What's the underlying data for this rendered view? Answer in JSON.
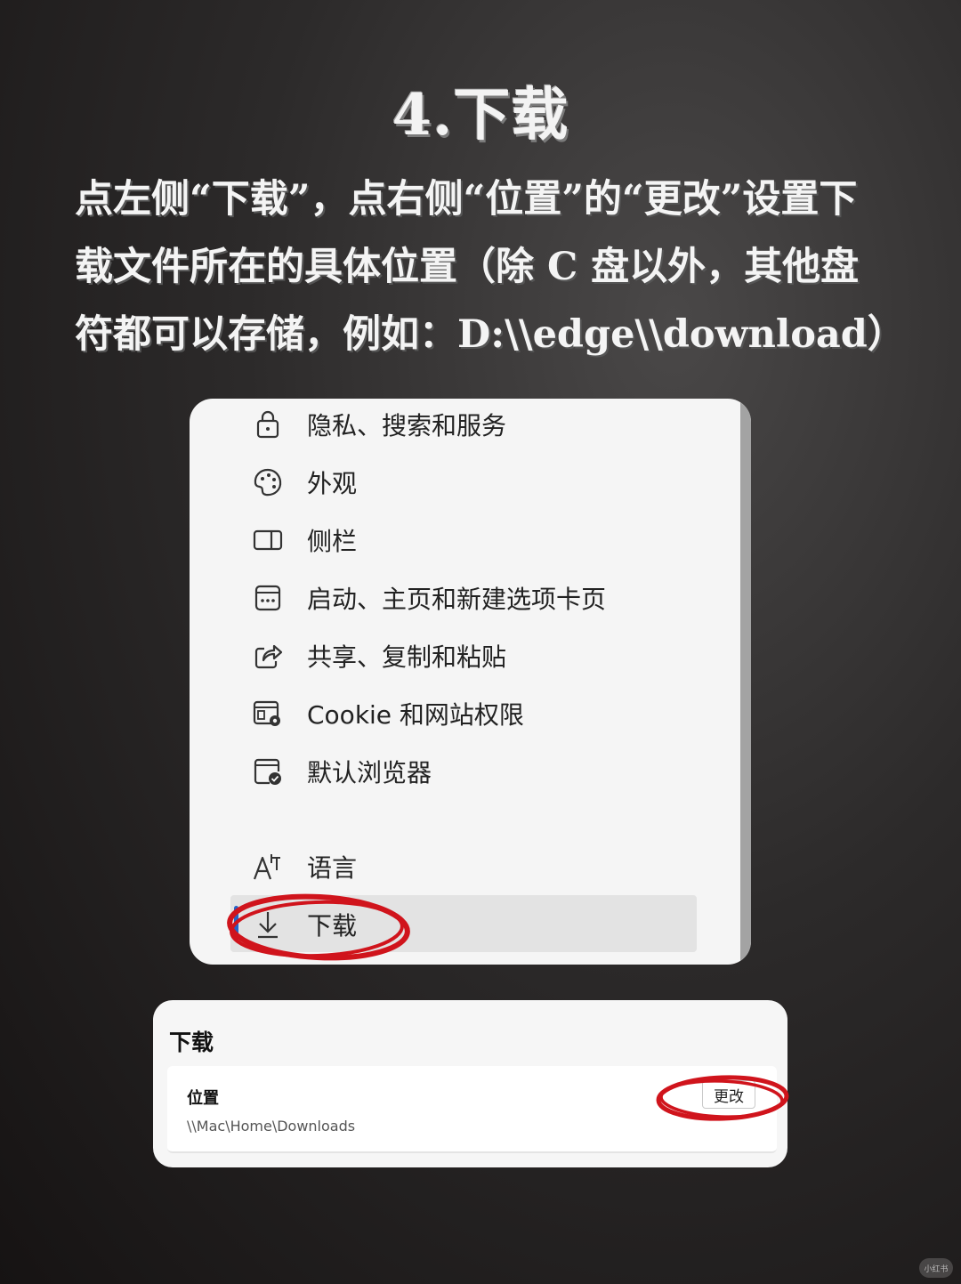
{
  "heading": "4.下载",
  "instruction": "点左侧“下载”，点右侧“位置”的“更改”设置下载文件所在的具体位置（除 C 盘以外，其他盘符都可以存储，例如：D:\\\\edge\\\\download）",
  "settings_menu": {
    "items": [
      {
        "label": "隐私、搜索和服务",
        "icon": "lock-icon"
      },
      {
        "label": "外观",
        "icon": "palette-icon"
      },
      {
        "label": "侧栏",
        "icon": "sidebar-icon"
      },
      {
        "label": "启动、主页和新建选项卡页",
        "icon": "start-page-icon"
      },
      {
        "label": "共享、复制和粘贴",
        "icon": "share-icon"
      },
      {
        "label": "Cookie 和网站权限",
        "icon": "cookie-permissions-icon"
      },
      {
        "label": "默认浏览器",
        "icon": "default-browser-icon"
      },
      {
        "label": "语言",
        "icon": "language-icon"
      },
      {
        "label": "下载",
        "icon": "download-icon",
        "selected": true
      }
    ]
  },
  "download_settings": {
    "title": "下载",
    "location_label": "位置",
    "location_path": "\\\\Mac\\Home\\Downloads",
    "change_button": "更改"
  },
  "annotation_color": "#d0141c",
  "accent_color": "#2563c7",
  "watermark": "小红书"
}
